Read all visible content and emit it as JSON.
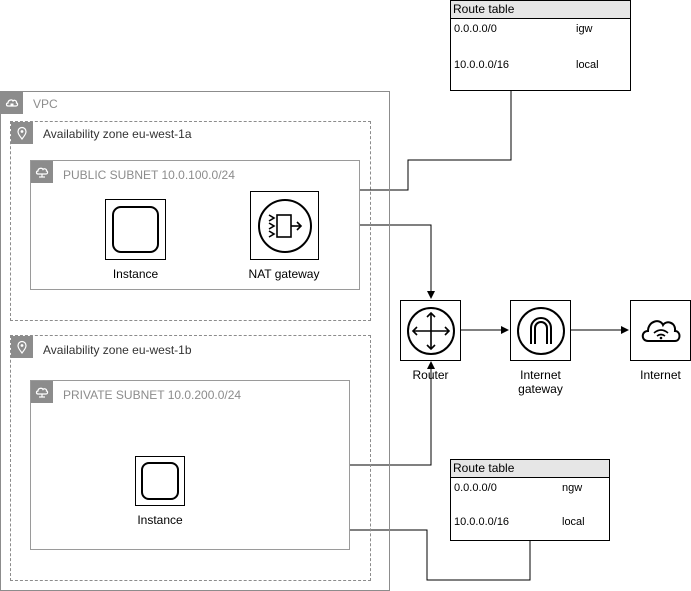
{
  "vpc": {
    "label": "VPC",
    "icon": "cloud-lock-icon",
    "az_a": {
      "label": "Availability zone eu-west-1a",
      "icon": "location-pin-icon",
      "subnet": {
        "label": "PUBLIC SUBNET 10.0.100.0/24",
        "icon": "subnet-cloud-icon",
        "instance_label": "Instance",
        "nat_label": "NAT gateway"
      }
    },
    "az_b": {
      "label": "Availability zone eu-west-1b",
      "icon": "location-pin-icon",
      "subnet": {
        "label": "PRIVATE SUBNET 10.0.200.0/24",
        "icon": "subnet-cloud-icon",
        "instance_label": "Instance"
      }
    }
  },
  "router": {
    "label": "Router",
    "icon": "router-icon"
  },
  "internet_gateway": {
    "label_line1": "Internet",
    "label_line2": "gateway",
    "icon": "internet-gateway-icon"
  },
  "internet": {
    "label": "Internet",
    "icon": "internet-cloud-icon"
  },
  "route_table_public": {
    "title": "Route table",
    "rows": [
      {
        "destination": "0.0.0.0/0",
        "target": "igw"
      },
      {
        "destination": "10.0.0.0/16",
        "target": "local"
      }
    ]
  },
  "route_table_private": {
    "title": "Route table",
    "rows": [
      {
        "destination": "0.0.0.0/0",
        "target": "ngw"
      },
      {
        "destination": "10.0.0.0/16",
        "target": "local"
      }
    ]
  },
  "colors": {
    "group_gray": "#8c8c8c",
    "table_header": "#e6e6e6",
    "line": "#000000"
  }
}
